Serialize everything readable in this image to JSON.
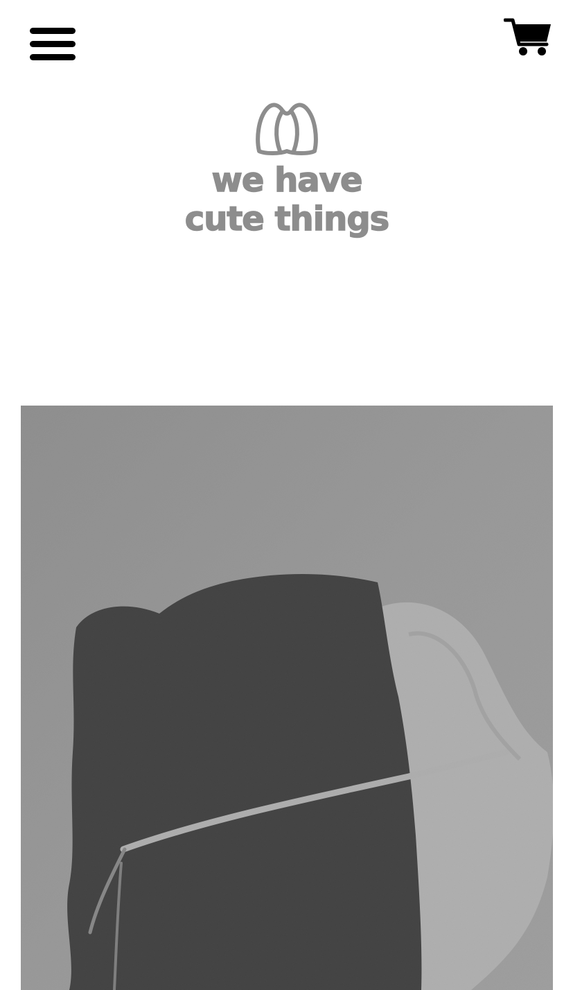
{
  "header": {
    "menu_icon": "hamburger-menu-icon",
    "cart_icon": "shopping-cart-icon"
  },
  "logo": {
    "mark_icon": "bunny-ears-logo-icon",
    "line1": "we have",
    "line2": "cute things",
    "color": "#8d8d8d"
  },
  "hero": {
    "subject": "black and white photo of a black fleece bonnet with white ribbon tie"
  }
}
